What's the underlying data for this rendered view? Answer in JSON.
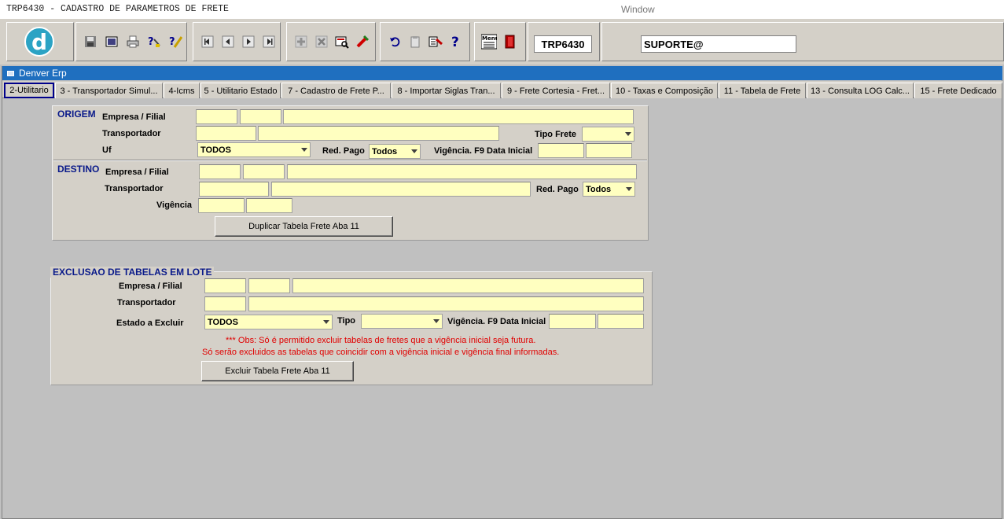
{
  "window": {
    "app_title": "TRP6430 - CADASTRO DE PARAMETROS DE FRETE",
    "menu_label": "Window",
    "inner_title": "Denver Erp"
  },
  "toolbar": {
    "logo_letter": "d",
    "form_code": "TRP6430",
    "user": "SUPORTE@",
    "icons": [
      "save-icon",
      "window-icon",
      "print-icon",
      "help-query-icon",
      "edit-icon",
      "first-record-icon",
      "prev-record-icon",
      "next-record-icon",
      "last-record-icon",
      "add-record-icon",
      "delete-record-icon",
      "search-icon",
      "clear-icon",
      "undo-icon",
      "clipboard-icon",
      "tools-icon",
      "question-icon",
      "menu-icon",
      "exit-icon"
    ]
  },
  "tabs": [
    {
      "label": "2-Utilitario",
      "active": true
    },
    {
      "label": "3 - Transportador Simul..."
    },
    {
      "label": "4-Icms"
    },
    {
      "label": "5 - Utilitario Estado"
    },
    {
      "label": "7 - Cadastro de Frete P..."
    },
    {
      "label": "8 - Importar Siglas Tran..."
    },
    {
      "label": "9 - Frete Cortesia - Fret..."
    },
    {
      "label": "10 - Taxas e Composição"
    },
    {
      "label": "11 - Tabela de Frete"
    },
    {
      "label": "13 - Consulta LOG Calc..."
    },
    {
      "label": "15 - Frete Dedicado"
    }
  ],
  "origem": {
    "title": "ORIGEM",
    "empresa_filial_label": "Empresa / Filial",
    "transportador_label": "Transportador",
    "tipo_frete_label": "Tipo Frete",
    "tipo_frete_value": "",
    "uf_label": "Uf",
    "uf_value": "TODOS",
    "red_pago_label": "Red. Pago",
    "red_pago_value": "Todos",
    "vigencia_label": "Vigência. F9 Data Inicial"
  },
  "destino": {
    "title": "DESTINO",
    "empresa_filial_label": "Empresa / Filial",
    "transportador_label": "Transportador",
    "red_pago_label": "Red. Pago",
    "red_pago_value": "Todos",
    "vigencia_label": "Vigência",
    "duplicar_button": "Duplicar Tabela Frete Aba 11"
  },
  "exclusao": {
    "title": "EXCLUSAO DE TABELAS EM LOTE",
    "empresa_filial_label": "Empresa / Filial",
    "transportador_label": "Transportador",
    "estado_label": "Estado a Excluir",
    "estado_value": "TODOS",
    "tipo_label": "Tipo",
    "tipo_value": "",
    "vigencia_label": "Vigência. F9 Data Inicial",
    "obs_line1": "*** Obs: Só é permitido excluir tabelas de fretes que a vigência inicial seja futura.",
    "obs_line2": "Só serão excluidos as tabelas que coincidir com a vigência inicial e vigência final informadas.",
    "excluir_button": "Excluir Tabela Frete Aba 11"
  }
}
